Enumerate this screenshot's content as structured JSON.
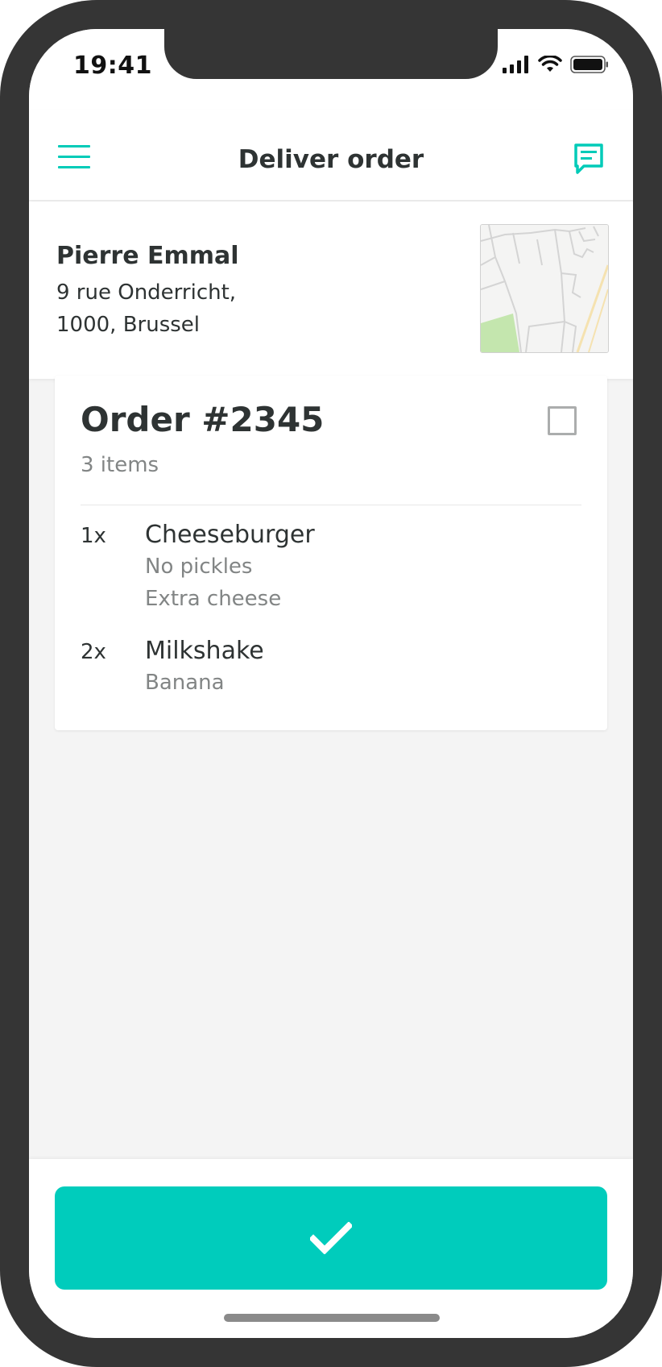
{
  "status_bar": {
    "time": "19:41",
    "icons": [
      "signal-icon",
      "wifi-icon",
      "battery-icon"
    ]
  },
  "header": {
    "title": "Deliver order",
    "menu_icon": "hamburger-menu-icon",
    "chat_icon": "chat-icon"
  },
  "customer": {
    "name": "Pierre Emmal",
    "address_line1": "9 rue Onderricht,",
    "address_line2": "1000, Brussel"
  },
  "order": {
    "title": "Order #2345",
    "item_count": "3 items",
    "items": [
      {
        "qty": "1x",
        "name": "Cheeseburger",
        "notes": [
          "No pickles",
          "Extra cheese"
        ]
      },
      {
        "qty": "2x",
        "name": "Milkshake",
        "notes": [
          "Banana"
        ]
      }
    ]
  },
  "actions": {
    "confirm_icon": "checkmark-icon"
  },
  "colors": {
    "accent": "#00ccbc",
    "text_primary": "#2e3333",
    "text_secondary": "#828585",
    "background": "#f4f4f4"
  }
}
